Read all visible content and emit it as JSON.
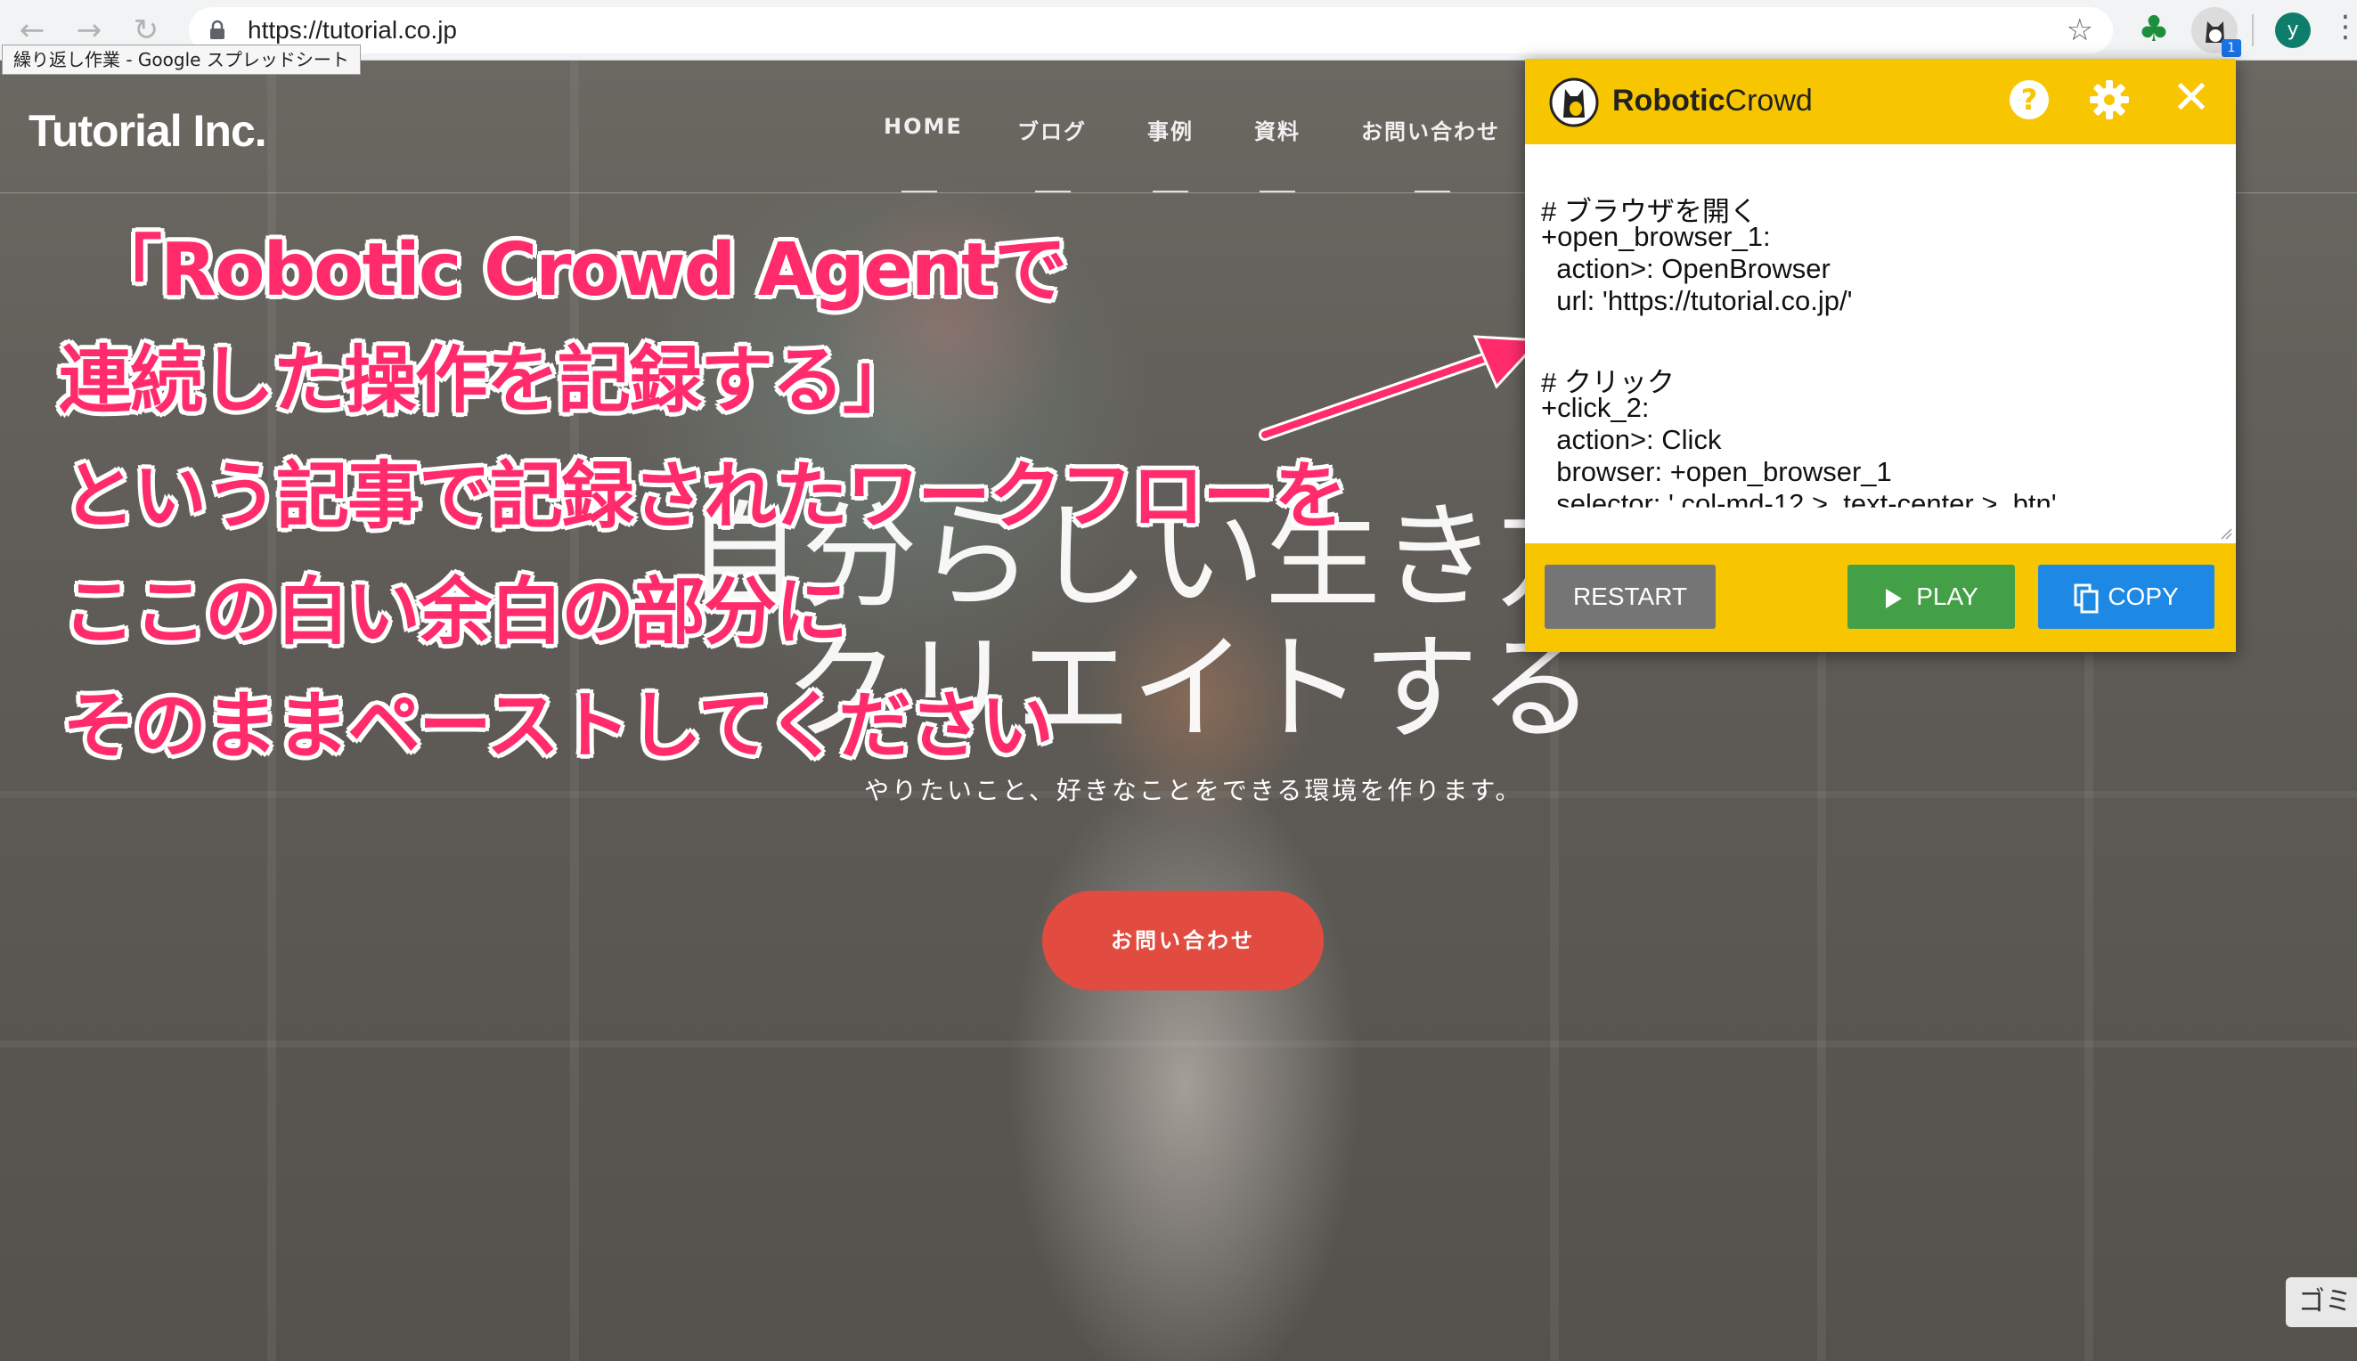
{
  "browser": {
    "url": "https://tutorial.co.jp",
    "tab_tooltip": "繰り返し作業 - Google スプレッドシート",
    "profile_initial": "y",
    "extension_badge": "1"
  },
  "site": {
    "logo": "Tutorial Inc.",
    "nav": [
      "HOME",
      "ブログ",
      "事例",
      "資料",
      "お問い合わせ"
    ],
    "hero_title_line1": "自分らしい生き方",
    "hero_title_line2": "クリエイトする",
    "hero_subtitle": "やりたいこと、好きなことをできる環境を作ります。",
    "cta_label": "お問い合わせ"
  },
  "annotation": {
    "lines": [
      "「Robotic Crowd Agentで",
      "連続した操作を記録する」",
      "という記事で記録されたワークフローを",
      "ここの白い余白の部分に",
      "そのままペーストしてください"
    ],
    "color": "#ff2b6a"
  },
  "extension": {
    "brand_bold": "Robotic",
    "brand_light": "Crowd",
    "accent_color": "#f7c600",
    "code_lines": [
      "# ブラウザを開く",
      "+open_browser_1:",
      "  action>: OpenBrowser",
      "  url: 'https://tutorial.co.jp/'",
      "",
      "# クリック",
      "+click_2:",
      "  action>: Click",
      "  browser: +open_browser_1",
      "  selector: '.col-md-12 > .text-center > .btn'"
    ],
    "buttons": {
      "restart": "RESTART",
      "play": "PLAY",
      "copy": "COPY"
    }
  },
  "corner_tab": "ゴミ"
}
